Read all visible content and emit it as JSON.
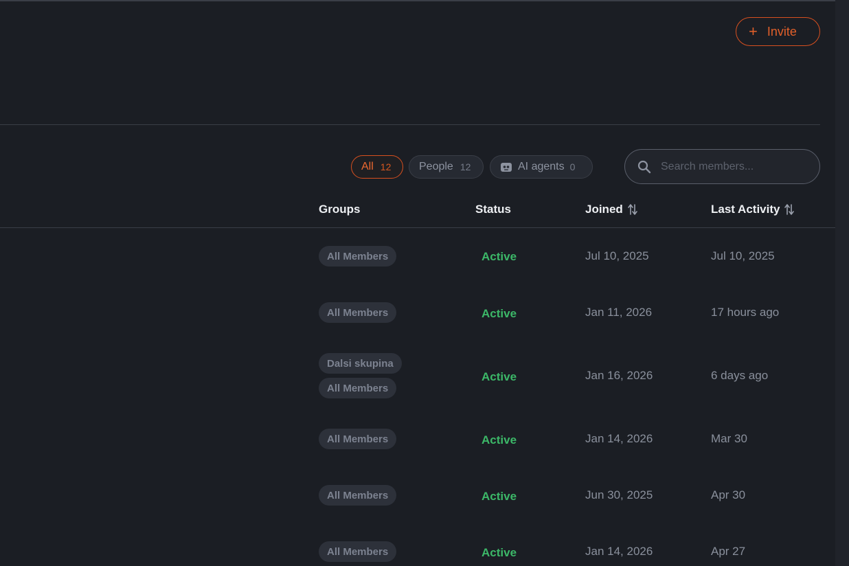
{
  "header": {
    "invite_label": "Invite"
  },
  "filters": {
    "all": {
      "label": "All",
      "count": "12"
    },
    "people": {
      "label": "People",
      "count": "12"
    },
    "agents": {
      "label": "AI agents",
      "count": "0"
    }
  },
  "search": {
    "placeholder": "Search members..."
  },
  "columns": {
    "groups": "Groups",
    "status": "Status",
    "joined": "Joined",
    "last_activity": "Last Activity"
  },
  "rows": [
    {
      "groups": [
        "All Members"
      ],
      "status": "Active",
      "joined": "Jul 10, 2025",
      "last_activity": "Jul 10, 2025"
    },
    {
      "groups": [
        "All Members"
      ],
      "status": "Active",
      "joined": "Jan 11, 2026",
      "last_activity": "17 hours ago"
    },
    {
      "groups": [
        "Dalsi skupina",
        "All Members"
      ],
      "status": "Active",
      "joined": "Jan 16, 2026",
      "last_activity": "6 days ago"
    },
    {
      "groups": [
        "All Members"
      ],
      "status": "Active",
      "joined": "Jan 14, 2026",
      "last_activity": "Mar 30"
    },
    {
      "groups": [
        "All Members"
      ],
      "status": "Active",
      "joined": "Jun 30, 2025",
      "last_activity": "Apr 30"
    },
    {
      "groups": [
        "All Members"
      ],
      "status": "Active",
      "joined": "Jan 14, 2026",
      "last_activity": "Apr 27"
    }
  ],
  "colors": {
    "accent": "#e2602a",
    "active_status": "#3cb868",
    "background": "#1b1e24"
  },
  "icons": {
    "invite": "plus-icon",
    "agents": "robot-icon",
    "search": "search-icon",
    "sort": "sort-icon"
  }
}
